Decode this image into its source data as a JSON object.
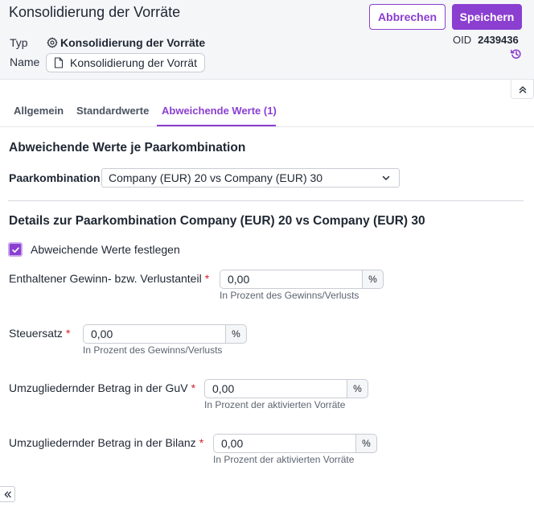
{
  "header": {
    "title": "Konsolidierung der Vorräte",
    "typ_label": "Typ",
    "typ_value": "Konsolidierung der Vorräte",
    "name_label": "Name",
    "name_value": "Konsolidierung der Vorrät",
    "cancel_label": "Abbrechen",
    "save_label": "Speichern",
    "oid_label": "OID",
    "oid_value": "2439436"
  },
  "tabs": [
    {
      "label": "Allgemein",
      "active": false
    },
    {
      "label": "Standardwerte",
      "active": false
    },
    {
      "label": "Abweichende Werte (1)",
      "active": true
    }
  ],
  "section1": {
    "title": "Abweichende Werte je Paarkombination",
    "pair_label": "Paarkombination",
    "pair_value": "Company (EUR) 20 vs Company (EUR) 30"
  },
  "section2": {
    "title": "Details zur Paarkombination Company (EUR) 20 vs Company (EUR) 30",
    "checkbox_label": "Abweichende Werte festlegen",
    "checkbox_checked": true,
    "required_mark": "*",
    "fields": [
      {
        "label": "Enthaltener Gewinn- bzw. Verlustanteil",
        "value": "0,00",
        "unit": "%",
        "hint": "In Prozent des Gewinns/Verlusts"
      },
      {
        "label": "Steuersatz",
        "value": "0,00",
        "unit": "%",
        "hint": "In Prozent des Gewinns/Verlusts"
      },
      {
        "label": "Umzugliedernder Betrag in der GuV",
        "value": "0,00",
        "unit": "%",
        "hint": "In Prozent der aktivierten Vorräte"
      },
      {
        "label": "Umzugliedernder Betrag in der Bilanz",
        "value": "0,00",
        "unit": "%",
        "hint": "In Prozent der aktivierten Vorräte"
      }
    ]
  },
  "colors": {
    "accent": "#8a3fd1",
    "required": "#d6202a",
    "header_bg": "#f5f6f8"
  },
  "icons": [
    "settings-cog-icon",
    "document-icon",
    "history-icon",
    "chevron-up-double-icon",
    "chevron-down-icon",
    "check-icon",
    "chevron-left-double-icon"
  ]
}
